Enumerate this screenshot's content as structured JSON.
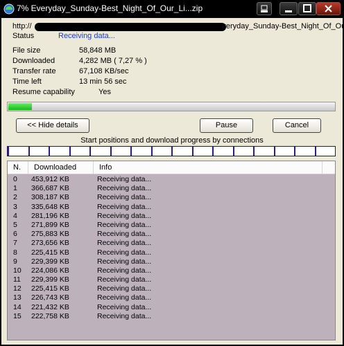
{
  "window": {
    "title": "7% Everyday_Sunday-Best_Night_Of_Our_Li...zip"
  },
  "download": {
    "url_prefix": "http://",
    "url_suffix": "/Everyday_Sunday-Best_Night_Of_Our",
    "status_label": "Status",
    "status_value": "Receiving data...",
    "fields": [
      {
        "label": "File size",
        "value": "58,848  MB"
      },
      {
        "label": "Downloaded",
        "value": "4,282  MB  ( 7,27 % )"
      },
      {
        "label": "Transfer rate",
        "value": "67,108  KB/sec"
      },
      {
        "label": "Time left",
        "value": "13 min 56 sec"
      },
      {
        "label": "Resume capability",
        "value": "Yes"
      }
    ],
    "progress_fraction": 0.0727
  },
  "buttons": {
    "hide_details": "<< Hide details",
    "pause": "Pause",
    "cancel": "Cancel"
  },
  "connections": {
    "title": "Start positions and download progress by connections",
    "count": 16
  },
  "table": {
    "headers": {
      "n": "N.",
      "downloaded": "Downloaded",
      "info": "Info"
    },
    "rows": [
      {
        "n": "0",
        "downloaded": "453,912  KB",
        "info": "Receiving data..."
      },
      {
        "n": "1",
        "downloaded": "366,687  KB",
        "info": "Receiving data..."
      },
      {
        "n": "2",
        "downloaded": "308,187  KB",
        "info": "Receiving data..."
      },
      {
        "n": "3",
        "downloaded": "335,648  KB",
        "info": "Receiving data..."
      },
      {
        "n": "4",
        "downloaded": "281,196  KB",
        "info": "Receiving data..."
      },
      {
        "n": "5",
        "downloaded": "271,899  KB",
        "info": "Receiving data..."
      },
      {
        "n": "6",
        "downloaded": "275,883  KB",
        "info": "Receiving data..."
      },
      {
        "n": "7",
        "downloaded": "273,656  KB",
        "info": "Receiving data..."
      },
      {
        "n": "8",
        "downloaded": "225,415  KB",
        "info": "Receiving data..."
      },
      {
        "n": "9",
        "downloaded": "229,399  KB",
        "info": "Receiving data..."
      },
      {
        "n": "10",
        "downloaded": "224,086  KB",
        "info": "Receiving data..."
      },
      {
        "n": "11",
        "downloaded": "229,399  KB",
        "info": "Receiving data..."
      },
      {
        "n": "12",
        "downloaded": "225,415  KB",
        "info": "Receiving data..."
      },
      {
        "n": "13",
        "downloaded": "226,743  KB",
        "info": "Receiving data..."
      },
      {
        "n": "14",
        "downloaded": "221,432  KB",
        "info": "Receiving data..."
      },
      {
        "n": "15",
        "downloaded": "222,758  KB",
        "info": "Receiving data..."
      }
    ]
  }
}
